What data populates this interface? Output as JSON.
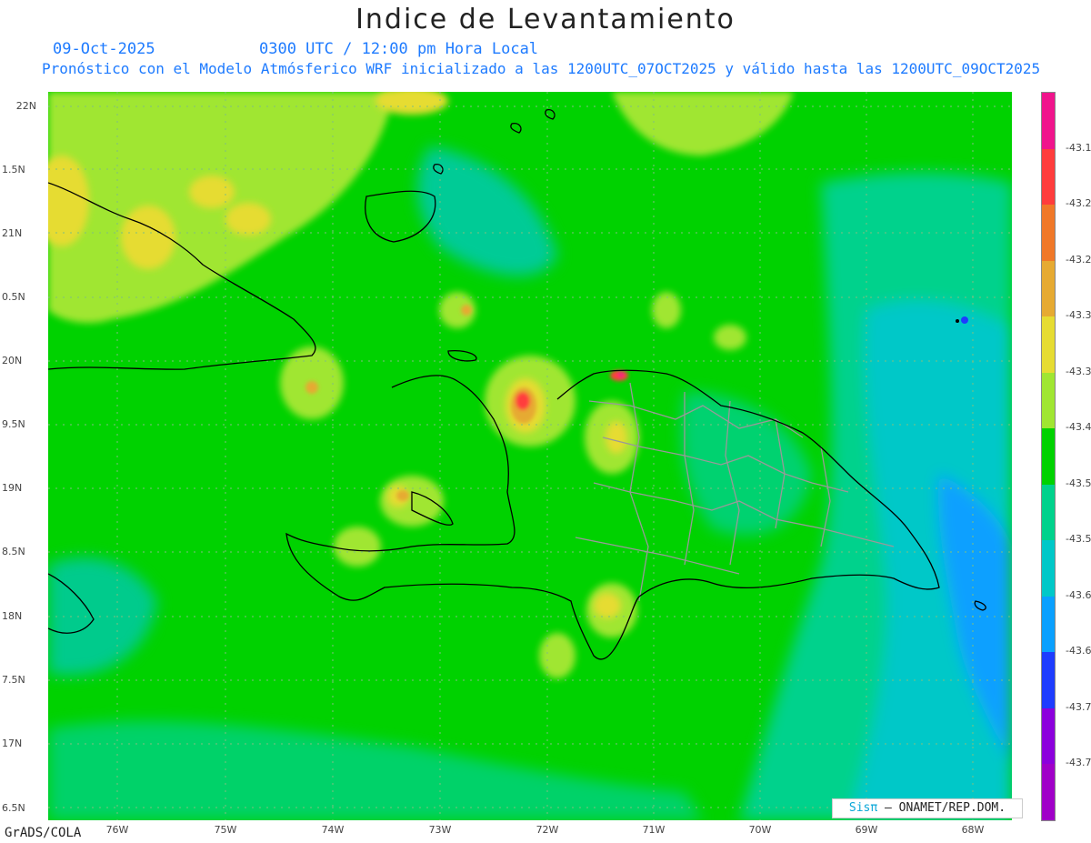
{
  "title": "Indice de Levantamiento",
  "subtitle_date": "09-Oct-2025",
  "subtitle_time": "0300 UTC / 12:00 pm Hora Local",
  "subtitle_model": "Pronóstico con el Modelo Atmósferico WRF inicializado a las 1200UTC_07OCT2025 y válido hasta las  1200UTC_09OCT2025",
  "y_axis": {
    "ticks": [
      "22N",
      "1.5N",
      "21N",
      "0.5N",
      "20N",
      "9.5N",
      "19N",
      "8.5N",
      "18N",
      "7.5N",
      "17N",
      "6.5N"
    ]
  },
  "x_axis": {
    "ticks": [
      "76W",
      "75W",
      "74W",
      "73W",
      "72W",
      "71W",
      "70W",
      "69W",
      "68W"
    ]
  },
  "colorbar": {
    "labels": [
      "-43.1",
      "-43.2",
      "-43.2",
      "-43.3",
      "-43.3",
      "-43.4",
      "-43.5",
      "-43.5",
      "-43.6",
      "-43.6",
      "-43.7",
      "-43.7"
    ],
    "colors": [
      "#f0148c",
      "#ff3c3c",
      "#f07828",
      "#e6aa32",
      "#e6dc32",
      "#a0e632",
      "#00d200",
      "#00d28c",
      "#00c8c8",
      "#0aa0ff",
      "#1e3cff",
      "#8c00dc",
      "#a000c8"
    ]
  },
  "footer": "GrADS/COLA",
  "credit": {
    "sis": "Sisπ",
    "rest": "– ONAMET/REP.DOM."
  },
  "colors": {
    "base_green": "#00d200",
    "light_green": "#a0e632",
    "teal": "#00d28c",
    "cyan": "#00c8c8",
    "blue": "#0aa0ff",
    "yellow": "#e6dc32",
    "orange": "#e6aa32",
    "red": "#ff3c3c"
  }
}
